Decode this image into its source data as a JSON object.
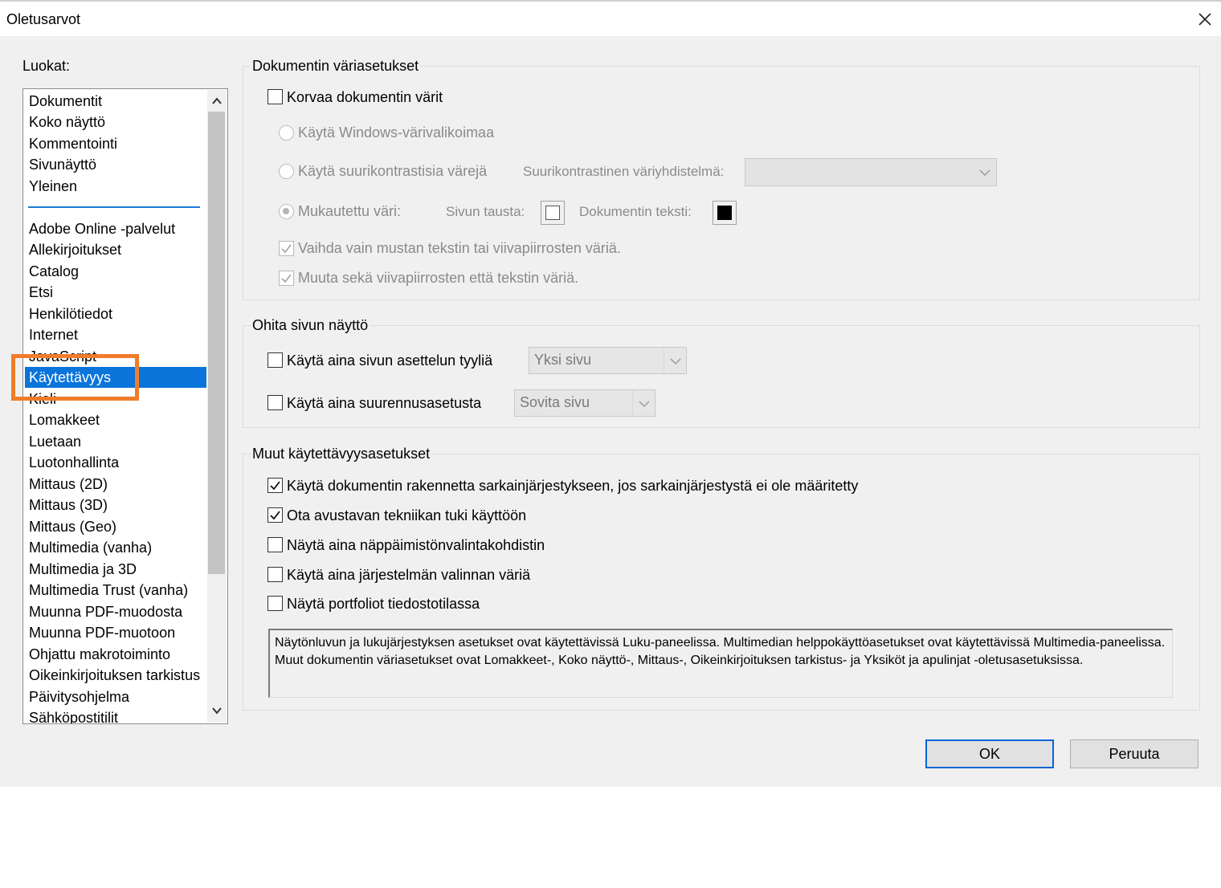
{
  "window": {
    "title": "Oletusarvot"
  },
  "categories": {
    "label": "Luokat:",
    "items": [
      "Dokumentit",
      "Koko näyttö",
      "Kommentointi",
      "Sivunäyttö",
      "Yleinen",
      "Adobe Online -palvelut",
      "Allekirjoitukset",
      "Catalog",
      "Etsi",
      "Henkilötiedot",
      "Internet",
      "JavaScript",
      "Käytettävyys",
      "Kieli",
      "Lomakkeet",
      "Luetaan",
      "Luotonhallinta",
      "Mittaus (2D)",
      "Mittaus (3D)",
      "Mittaus (Geo)",
      "Multimedia (vanha)",
      "Multimedia ja 3D",
      "Multimedia Trust (vanha)",
      "Muunna PDF-muodosta",
      "Muunna PDF-muotoon",
      "Ohjattu makrotoiminto",
      "Oikeinkirjoituksen tarkistus",
      "Päivitysohjelma",
      "Sähköpostitilit"
    ],
    "selected": "Käytettävyys"
  },
  "color_settings": {
    "title": "Dokumentin väriasetukset",
    "replace_colors": {
      "label": "Korvaa dokumentin värit",
      "checked": false
    },
    "windows_palette": {
      "label": "Käytä Windows-värivalikoimaa",
      "selected": false
    },
    "high_contrast": {
      "label": "Käytä suurikontrastisia värejä",
      "selected": false
    },
    "high_contrast_scheme": {
      "label": "Suurikontrastinen väriyhdistelmä:",
      "value": ""
    },
    "custom_color": {
      "label": "Mukautettu väri:",
      "selected": true
    },
    "page_background": {
      "label": "Sivun tausta:",
      "color": "#ffffff"
    },
    "document_text": {
      "label": "Dokumentin teksti:",
      "color": "#000000"
    },
    "only_black_text": {
      "label": "Vaihda vain mustan tekstin tai viivapiirrosten väriä.",
      "checked": true
    },
    "line_art_and_text": {
      "label": "Muuta sekä viivapiirrosten että tekstin väriä.",
      "checked": true
    }
  },
  "page_display": {
    "title": "Ohita sivun näyttö",
    "layout_style": {
      "label": "Käytä aina sivun asettelun tyyliä",
      "checked": false,
      "value": "Yksi sivu"
    },
    "zoom": {
      "label": "Käytä aina suurennusasetusta",
      "checked": false,
      "value": "Sovita sivu"
    }
  },
  "other": {
    "title": "Muut käytettävyysasetukset",
    "options": [
      {
        "label": "Käytä dokumentin rakennetta sarkainjärjestykseen, jos sarkainjärjestystä ei ole määritetty",
        "checked": true
      },
      {
        "label": "Ota avustavan tekniikan tuki käyttöön",
        "checked": true
      },
      {
        "label": "Näytä aina näppäimistönvalintakohdistin",
        "checked": false
      },
      {
        "label": "Käytä aina järjestelmän valinnan väriä",
        "checked": false
      },
      {
        "label": "Näytä portfoliot tiedostotilassa",
        "checked": false
      }
    ],
    "info": "Näytönluvun ja lukujärjestyksen asetukset ovat käytettävissä Luku-paneelissa. Multimedian helppokäyttöasetukset ovat käytettävissä Multimedia-paneelissa. Muut dokumentin väriasetukset ovat Lomakkeet-, Koko näyttö-, Mittaus-, Oikeinkirjoituksen tarkistus- ja Yksiköt ja apulinjat -oletusasetuksissa."
  },
  "buttons": {
    "ok": "OK",
    "cancel": "Peruuta"
  },
  "colors": {
    "selection": "#0a74da",
    "highlight": "#f07c2a",
    "default_button_border": "#0a64d6"
  }
}
